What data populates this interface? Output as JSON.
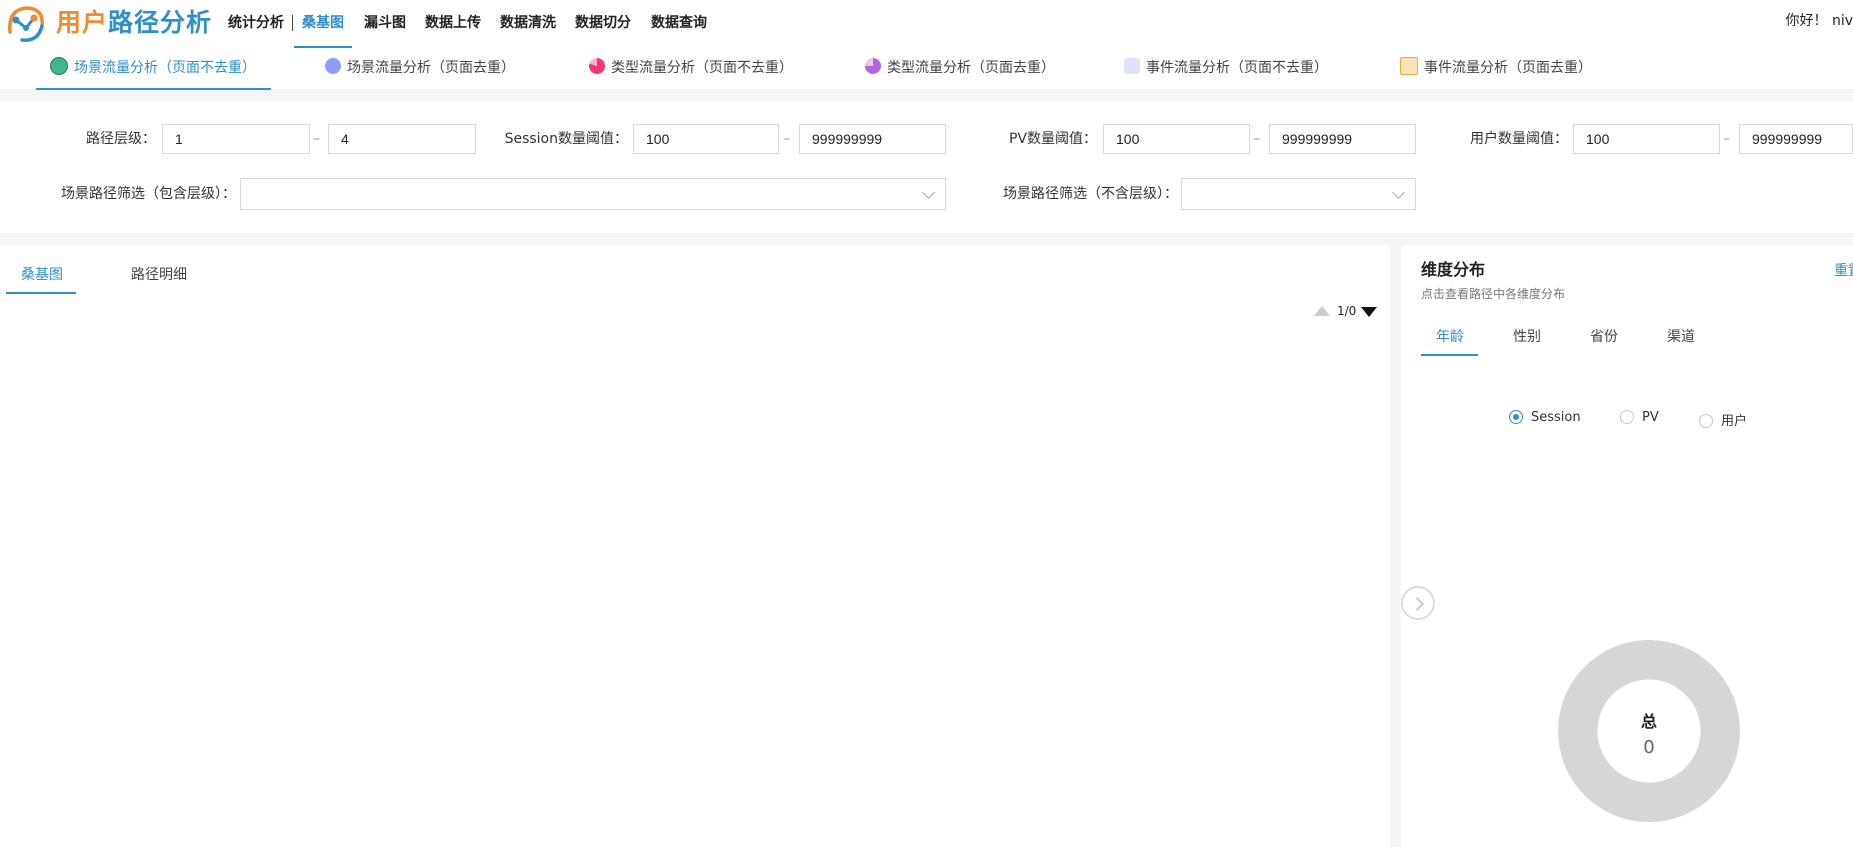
{
  "app": {
    "logo_part1": "用户",
    "logo_part2": "路径分析"
  },
  "nav": [
    {
      "label": "统计分析"
    },
    {
      "label": "桑基图"
    },
    {
      "label": "漏斗图"
    },
    {
      "label": "数据上传"
    },
    {
      "label": "数据清洗"
    },
    {
      "label": "数据切分"
    },
    {
      "label": "数据查询"
    }
  ],
  "nav_active": "桑基图",
  "greeting": "你好！ niv",
  "subtabs": [
    {
      "label": "场景流量分析（页面不去重）",
      "icon": "scene-chart-icon",
      "color": "#3fb68b"
    },
    {
      "label": "场景流量分析（页面去重）",
      "icon": "scene-wave-icon",
      "color": "#8f9df5"
    },
    {
      "label": "类型流量分析（页面不去重）",
      "icon": "pie-icon",
      "color": "#f0377a"
    },
    {
      "label": "类型流量分析（页面去重）",
      "icon": "pie-purple-icon",
      "color": "#b864dc"
    },
    {
      "label": "事件流量分析（页面不去重）",
      "icon": "bar-chart-icon",
      "color": "#7f8ee8"
    },
    {
      "label": "事件流量分析（页面去重）",
      "icon": "clipboard-icon",
      "color": "#f2a93b"
    }
  ],
  "filters": {
    "level_label": "路径层级：",
    "level_min": "1",
    "level_max": "4",
    "session_label": "Session数量阈值：",
    "session_min": "100",
    "session_max": "999999999",
    "pv_label": "PV数量阈值：",
    "pv_min": "100",
    "pv_max": "999999999",
    "user_label": "用户数量阈值：",
    "user_min": "100",
    "user_max": "999999999",
    "dash": "–",
    "include_label": "场景路径筛选（包含层级）：",
    "exclude_label": "场景路径筛选（不含层级）："
  },
  "left_tabs": [
    {
      "label": "桑基图"
    },
    {
      "label": "路径明细"
    }
  ],
  "pager": {
    "text": "1/0"
  },
  "dimension": {
    "title": "维度分布",
    "subtitle": "点击查看路径中各维度分布",
    "reset": "重置",
    "tabs": [
      {
        "label": "年龄"
      },
      {
        "label": "性别"
      },
      {
        "label": "省份"
      },
      {
        "label": "渠道"
      }
    ],
    "radios": [
      {
        "label": "Session",
        "checked": true
      },
      {
        "label": "PV",
        "checked": false
      },
      {
        "label": "用户",
        "checked": false
      }
    ],
    "total_label": "总",
    "total_value": "0"
  }
}
